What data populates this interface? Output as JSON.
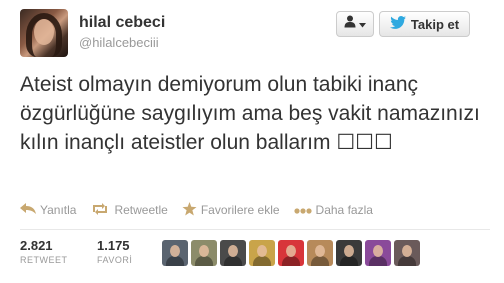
{
  "profile": {
    "fullname": "hilal cebeci",
    "username": "@hilalcebeciii",
    "avatar_icon": "profile-photo"
  },
  "buttons": {
    "user_actions_icon": "person-icon",
    "follow_label": "Takip et",
    "follow_icon": "twitter-bird-icon"
  },
  "tweet": {
    "text": "Ateist olmayın demiyorum olun tabiki inanç özgürlüğüne saygılıyım ama beş vakit namazınızı kılın inançlı ateistler olun ballarım ☐☐☐"
  },
  "actions": [
    {
      "label": "Yanıtla",
      "icon": "reply-arrow-icon"
    },
    {
      "label": "Retweetle",
      "icon": "retweet-icon"
    },
    {
      "label": "Favorilere ekle",
      "icon": "star-icon"
    },
    {
      "label": "Daha fazla",
      "icon": "more-dots-icon"
    }
  ],
  "stats": {
    "retweets": {
      "count": "2.821",
      "label": "RETWEET"
    },
    "favorites": {
      "count": "1.175",
      "label": "FAVORİ"
    }
  },
  "colors": {
    "accent": "#c8a870",
    "twitter_blue": "#2fa9e0",
    "text": "#333333",
    "muted": "#999999"
  }
}
